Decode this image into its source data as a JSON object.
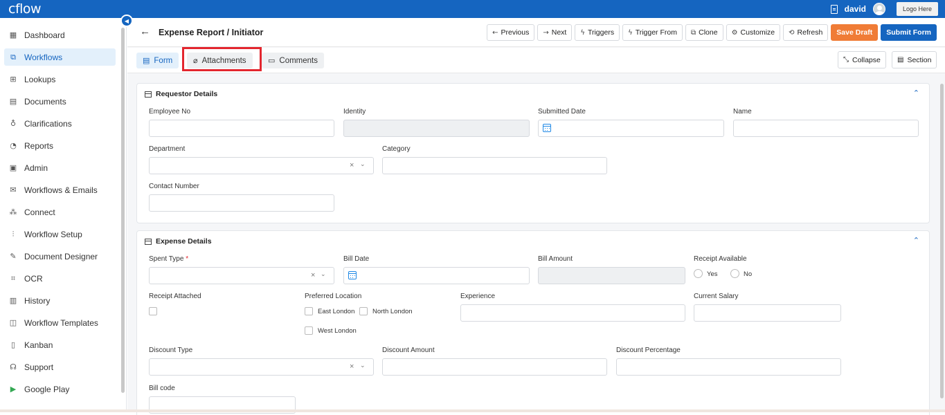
{
  "app": {
    "logo": "cflow",
    "username": "david",
    "logo_placeholder": "Logo Here"
  },
  "sidebar": {
    "items": [
      {
        "label": "Dashboard",
        "icon": "dashboard-icon",
        "active": false
      },
      {
        "label": "Workflows",
        "icon": "workflows-icon",
        "active": true
      },
      {
        "label": "Lookups",
        "icon": "table-icon",
        "active": false
      },
      {
        "label": "Documents",
        "icon": "document-icon",
        "active": false
      },
      {
        "label": "Clarifications",
        "icon": "lightbulb-icon",
        "active": false
      },
      {
        "label": "Reports",
        "icon": "pie-chart-icon",
        "active": false
      },
      {
        "label": "Admin",
        "icon": "admin-icon",
        "active": false
      },
      {
        "label": "Workflows & Emails",
        "icon": "mail-icon",
        "active": false
      },
      {
        "label": "Connect",
        "icon": "connect-icon",
        "active": false
      },
      {
        "label": "Workflow Setup",
        "icon": "sliders-icon",
        "active": false
      },
      {
        "label": "Document Designer",
        "icon": "edit-document-icon",
        "active": false
      },
      {
        "label": "OCR",
        "icon": "scan-icon",
        "active": false
      },
      {
        "label": "History",
        "icon": "history-icon",
        "active": false
      },
      {
        "label": "Workflow Templates",
        "icon": "templates-icon",
        "active": false
      },
      {
        "label": "Kanban",
        "icon": "kanban-icon",
        "active": false
      },
      {
        "label": "Support",
        "icon": "support-icon",
        "active": false
      },
      {
        "label": "Google Play",
        "icon": "google-play-icon",
        "active": false
      }
    ]
  },
  "header": {
    "title": "Expense Report / Initiator",
    "buttons": {
      "previous": "Previous",
      "next": "Next",
      "triggers": "Triggers",
      "trigger_from": "Trigger From",
      "clone": "Clone",
      "customize": "Customize",
      "refresh": "Refresh",
      "save_draft": "Save Draft",
      "submit_form": "Submit Form"
    }
  },
  "tabs": {
    "form": "Form",
    "attachments": "Attachments",
    "comments": "Comments",
    "collapse": "Collapse",
    "section": "Section"
  },
  "requestor": {
    "title": "Requestor Details",
    "employee_no": "Employee No",
    "identity": "Identity",
    "submitted_date": "Submitted Date",
    "name": "Name",
    "department": "Department",
    "category": "Category",
    "contact_number": "Contact Number"
  },
  "expense": {
    "title": "Expense Details",
    "spent_type": "Spent Type",
    "required_mark": "*",
    "bill_date": "Bill Date",
    "bill_amount": "Bill Amount",
    "receipt_available": "Receipt Available",
    "yes": "Yes",
    "no": "No",
    "receipt_attached": "Receipt Attached",
    "preferred_location": "Preferred Location",
    "east_london": "East London",
    "north_london": "North London",
    "west_london": "West London",
    "experience": "Experience",
    "current_salary": "Current Salary",
    "discount_type": "Discount Type",
    "discount_amount": "Discount Amount",
    "discount_percentage": "Discount Percentage",
    "bill_code": "Bill code"
  },
  "colors": {
    "brand": "#1565c0",
    "save_draft": "#f07c36",
    "highlight": "#e3262e"
  }
}
